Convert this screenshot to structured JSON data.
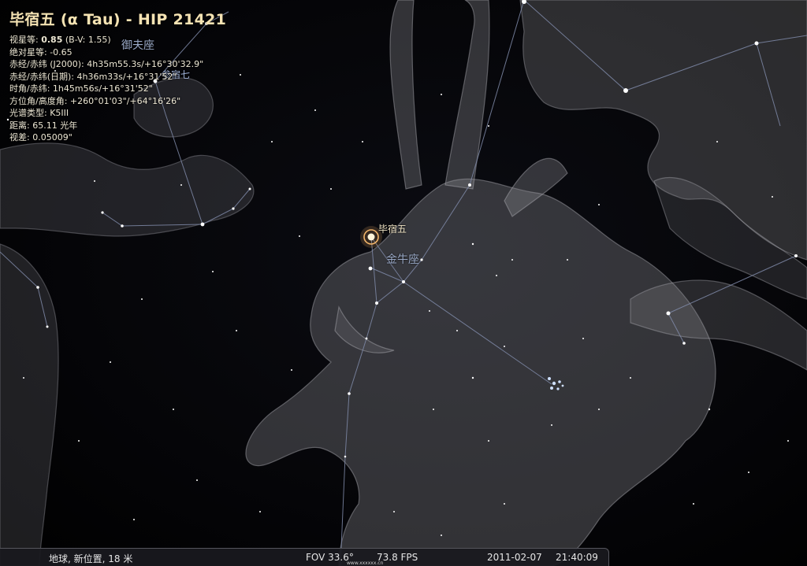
{
  "window": {
    "app": "Stellarium"
  },
  "object_info": {
    "title": "毕宿五 (α Tau) - HIP 21421",
    "vmag_label": "视星等:",
    "vmag_value": "0.85",
    "vmag_suffix": "(B-V: 1.55)",
    "absmag": "绝对星等: -0.65",
    "radec_j2000": "赤经/赤纬 (J2000): 4h35m55.3s/+16°30'32.9\"",
    "radec_date": "赤经/赤纬(日期): 4h36m33s/+16°31'52\"",
    "hourangle": "时角/赤纬: 1h45m56s/+16°31'52\"",
    "azalt": "方位角/高度角: +260°01'03\"/+64°16'26\"",
    "spectral": "光谱类型: K5III",
    "distance": "距离: 65.11 光年",
    "parallax": "视差: 0.05009\""
  },
  "sky_labels": {
    "selected_star": "毕宿五",
    "taurus": "金牛座",
    "auriga": "御夫座",
    "orion_star": "参宿七"
  },
  "statusbar": {
    "location": "地球, 新位置, 18 米",
    "fov": "FOV 33.6°",
    "fps": "73.8 FPS",
    "date": "2011-02-07",
    "time": "21:40:09"
  },
  "watermark": "www.xxxxxx.cn",
  "colors": {
    "sky": "#000000",
    "constellation_lines": "#7f8aa8",
    "selected_marker": "#f2b46a",
    "art": "#6f6f74"
  },
  "icons": {
    "selected": "selection-ring-icon"
  }
}
